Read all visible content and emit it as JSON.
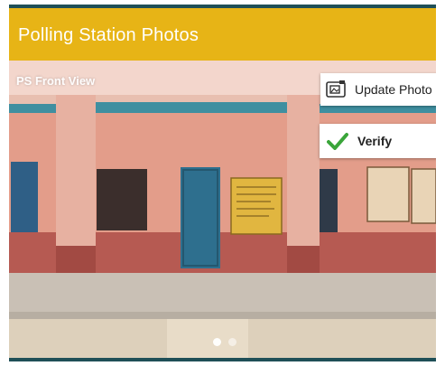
{
  "header": {
    "title": "Polling Station Photos",
    "color": "#e7b416"
  },
  "photo": {
    "caption": "PS Front View",
    "current_slide": 1,
    "slide_count": 2
  },
  "actions": {
    "update_label": "Update Photo",
    "update_icon": "image-edit-icon",
    "verify_label": "Verify",
    "verify_icon": "checkmark-icon",
    "verify_color": "#3aa53a"
  }
}
